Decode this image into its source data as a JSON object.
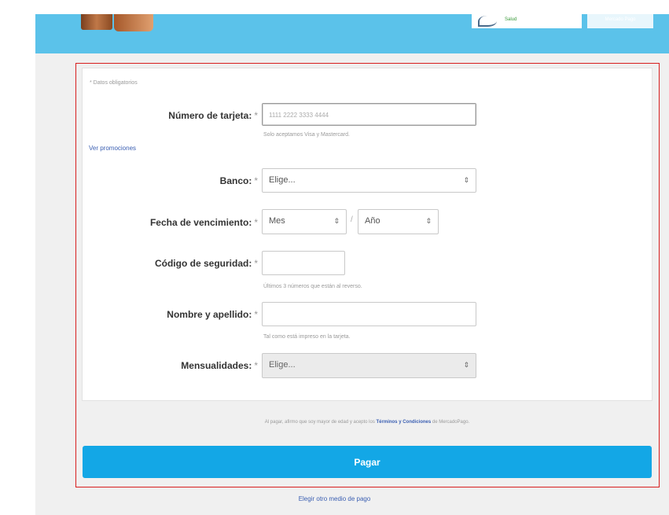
{
  "header": {
    "logo_text": "Salud",
    "right_button": "Mercado Pago"
  },
  "form": {
    "required_note": "* Datos obligatorios",
    "promotions_link": "Ver promociones",
    "card_number": {
      "label": "Número de tarjeta:",
      "placeholder": "1111 2222 3333 4444",
      "hint": "Solo aceptamos Visa y Mastercard."
    },
    "bank": {
      "label": "Banco:",
      "selected": "Elige..."
    },
    "expiry": {
      "label": "Fecha de vencimiento:",
      "month": "Mes",
      "year": "Año",
      "separator": "/"
    },
    "security_code": {
      "label": "Código de seguridad:",
      "hint": "Últimos 3 números que están al reverso."
    },
    "full_name": {
      "label": "Nombre y apellido:",
      "hint": "Tal como está impreso en la tarjeta."
    },
    "installments": {
      "label": "Mensualidades:",
      "selected": "Elige..."
    },
    "required_mark": "*"
  },
  "terms": {
    "prefix": "Al pagar, afirmo que soy mayor de edad y acepto los ",
    "link": "Términos y Condiciones",
    "suffix": " de MercadoPago."
  },
  "pay_button": "Pagar",
  "other_payment_link": "Elegir otro medio de pago",
  "colors": {
    "header": "#5bc2ea",
    "pay_button": "#13a7e6",
    "link": "#3b5fb2",
    "highlight_frame": "#d81e1e"
  }
}
